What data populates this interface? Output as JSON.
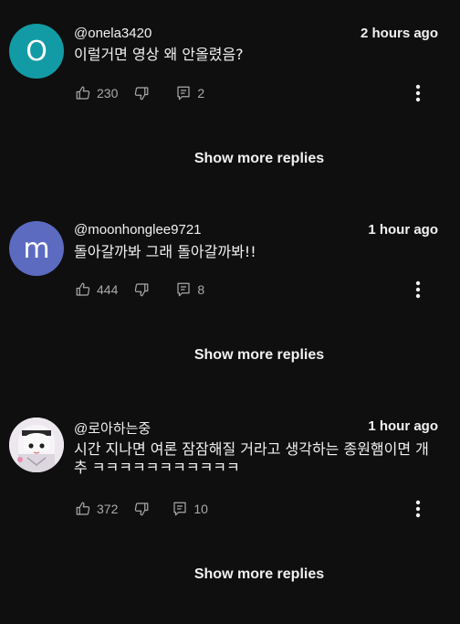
{
  "comments": [
    {
      "avatar_letter": "O",
      "avatar_color": "#139ba5",
      "handle": "@onela3420",
      "time": "2 hours ago",
      "text": "이럴거면 영상 왜 안올렸음?",
      "likes": "230",
      "replies": "2",
      "show_more": "Show more replies"
    },
    {
      "avatar_letter": "m",
      "avatar_color": "#5c6bc0",
      "handle": "@moonhonglee9721",
      "time": "1 hour ago",
      "text": "돌아갈까봐 그래 돌아갈까봐!!",
      "likes": "444",
      "replies": "8",
      "show_more": "Show more replies"
    },
    {
      "avatar_letter": "",
      "avatar_color": "#e9e4ea",
      "handle": "@로아하는중",
      "time": "1 hour ago",
      "text": "시간 지나면 여론 잠잠해질 거라고 생각하는 종원햄이면 개추 ㅋㅋㅋㅋㅋㅋㅋㅋㅋㅋㅋ",
      "likes": "372",
      "replies": "10",
      "show_more": "Show more replies"
    }
  ],
  "icons": {
    "like": "thumbs-up-icon",
    "dislike": "thumbs-down-icon",
    "reply": "reply-icon",
    "more": "more-vert-icon"
  }
}
